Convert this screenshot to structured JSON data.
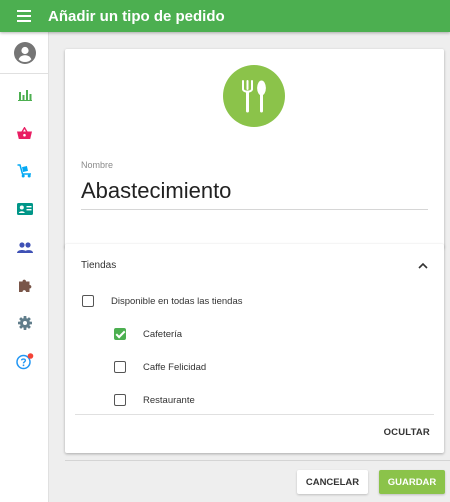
{
  "appbar": {
    "title": "Añadir un tipo de pedido",
    "menu_icon": "menu-icon",
    "color": "#4caf50"
  },
  "sidebar": {
    "avatar_icon": "account-circle-icon",
    "items": [
      {
        "icon": "bar-chart-icon",
        "color": "#4caf50"
      },
      {
        "icon": "shopping-basket-icon",
        "color": "#e91e63"
      },
      {
        "icon": "delivery-cart-icon",
        "color": "#03a9f4"
      },
      {
        "icon": "contact-card-icon",
        "color": "#009688"
      },
      {
        "icon": "people-icon",
        "color": "#3f51b5"
      },
      {
        "icon": "puzzle-icon",
        "color": "#795548"
      },
      {
        "icon": "gear-icon",
        "color": "#607d8b"
      },
      {
        "icon": "help-icon",
        "color": "#2196f3",
        "badge_color": "#f44336"
      }
    ]
  },
  "order_type": {
    "icon": "fork-knife-icon",
    "icon_color": "#8bc34a",
    "name_label": "Nombre",
    "name_value": "Abastecimiento"
  },
  "stores": {
    "title": "Tiendas",
    "collapse_icon": "chevron-up-icon",
    "all_stores_label": "Disponible en todas las tiendas",
    "all_stores_checked": false,
    "list": [
      {
        "name": "Cafetería",
        "checked": true
      },
      {
        "name": "Caffe Felicidad",
        "checked": false
      },
      {
        "name": "Restaurante",
        "checked": false
      }
    ],
    "hide_label": "OCULTAR"
  },
  "actions": {
    "cancel_label": "CANCELAR",
    "save_label": "GUARDAR"
  }
}
